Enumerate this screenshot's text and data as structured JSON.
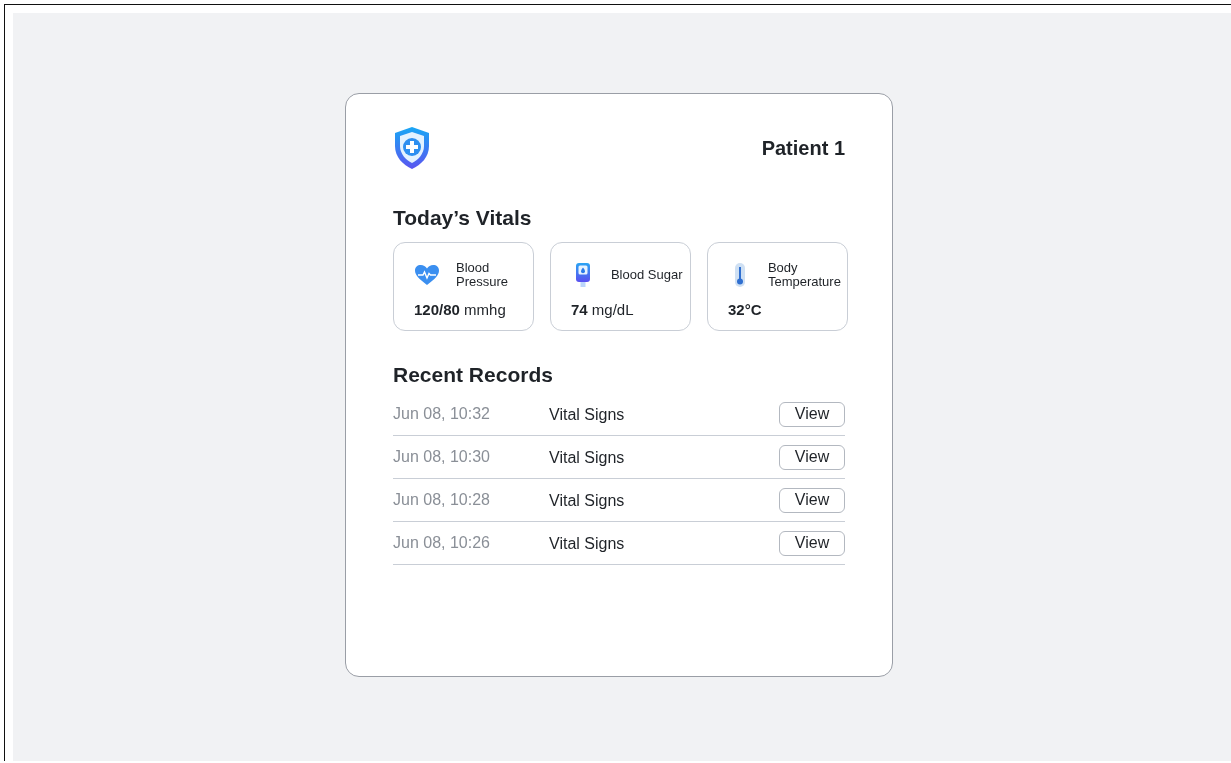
{
  "patient": {
    "name": "Patient 1"
  },
  "vitals": {
    "title": "Today’s Vitals",
    "items": [
      {
        "label": "Blood Pressure",
        "value": "**120/80** mmhg"
      },
      {
        "label": "Blood Sugar",
        "value": "**74** mg/dL"
      },
      {
        "label": "Body Temperature",
        "value": "**32°C**"
      }
    ]
  },
  "records": {
    "title": "Recent Records",
    "rows": [
      {
        "time": "Jun 08, 10:32",
        "type": "Vital Signs",
        "action": "View"
      },
      {
        "time": "Jun 08, 10:30",
        "type": "Vital Signs",
        "action": "View"
      },
      {
        "time": "Jun 08, 10:28",
        "type": "Vital Signs",
        "action": "View"
      },
      {
        "time": "Jun 08, 10:26",
        "type": "Vital Signs",
        "action": "View"
      }
    ]
  }
}
